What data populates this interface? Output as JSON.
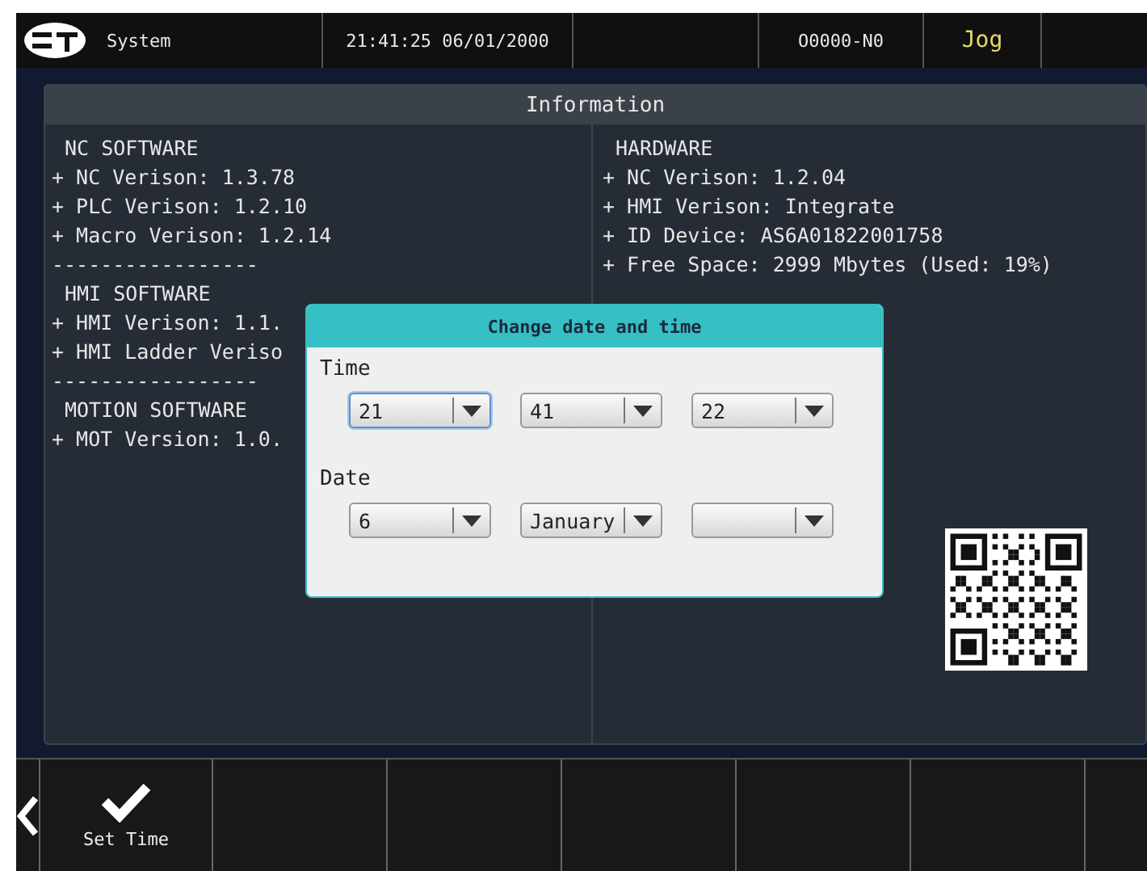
{
  "status_bar": {
    "mode_title": "System",
    "clock": "21:41:25 06/01/2000",
    "program": "O0000-N0",
    "operation_mode": "Jog"
  },
  "information": {
    "title": "Information",
    "left_lines": [
      {
        "kind": "heading",
        "text": "NC SOFTWARE"
      },
      {
        "kind": "item",
        "text": "+ NC Verison: 1.3.78"
      },
      {
        "kind": "item",
        "text": "+ PLC Verison: 1.2.10"
      },
      {
        "kind": "item",
        "text": "+ Macro Verison: 1.2.14"
      },
      {
        "kind": "separator",
        "text": "-----------------"
      },
      {
        "kind": "heading",
        "text": "HMI SOFTWARE"
      },
      {
        "kind": "item",
        "text": "+ HMI Verison: 1.1."
      },
      {
        "kind": "item",
        "text": "+ HMI Ladder Veriso"
      },
      {
        "kind": "separator",
        "text": "-----------------"
      },
      {
        "kind": "heading",
        "text": "MOTION SOFTWARE"
      },
      {
        "kind": "item",
        "text": "+ MOT Version: 1.0."
      }
    ],
    "right_lines": [
      {
        "kind": "heading",
        "text": "HARDWARE"
      },
      {
        "kind": "item",
        "text": "+ NC Verison: 1.2.04"
      },
      {
        "kind": "item",
        "text": "+ HMI Verison: Integrate"
      },
      {
        "kind": "item",
        "text": "+ ID Device: AS6A01822001758"
      },
      {
        "kind": "item",
        "text": "+ Free Space: 2999 Mbytes (Used: 19%)"
      }
    ]
  },
  "dialog": {
    "title": "Change date and time",
    "sections": [
      {
        "label": "Time",
        "dropdowns": [
          {
            "value": "21",
            "focused": true
          },
          {
            "value": "41",
            "focused": false
          },
          {
            "value": "22",
            "focused": false
          }
        ]
      },
      {
        "label": "Date",
        "dropdowns": [
          {
            "value": "6",
            "focused": false
          },
          {
            "value": "January",
            "focused": false
          },
          {
            "focused": false
          }
        ]
      }
    ]
  },
  "softkeys": [
    {
      "kind": "back"
    },
    {
      "kind": "confirm",
      "label": "Set Time"
    },
    {
      "kind": "empty"
    },
    {
      "kind": "empty"
    },
    {
      "kind": "empty"
    },
    {
      "kind": "empty"
    },
    {
      "kind": "empty"
    },
    {
      "kind": "empty"
    }
  ]
}
